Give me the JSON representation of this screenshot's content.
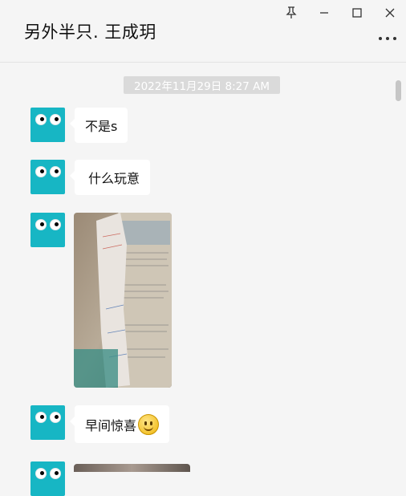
{
  "header": {
    "title": "另外半只. 王成玥",
    "pin_icon": "pin-icon",
    "minimize_icon": "minimize-icon",
    "maximize_icon": "maximize-icon",
    "close_icon": "close-icon",
    "more_icon": "more-icon"
  },
  "chat": {
    "timestamp": "2022年11月29日 8:27 AM",
    "messages": [
      {
        "type": "text",
        "text": "不是s"
      },
      {
        "type": "text",
        "text": "什么玩意"
      },
      {
        "type": "image",
        "description_icon": "photo-thumbnail"
      },
      {
        "type": "text",
        "text": "早间惊喜",
        "emoji": "smile-emoji"
      },
      {
        "type": "image",
        "description_icon": "photo-thumbnail"
      }
    ]
  },
  "colors": {
    "background": "#f5f5f5",
    "avatar": "#17b6c4",
    "bubble": "#ffffff",
    "timestamp_bg": "#dadada"
  }
}
